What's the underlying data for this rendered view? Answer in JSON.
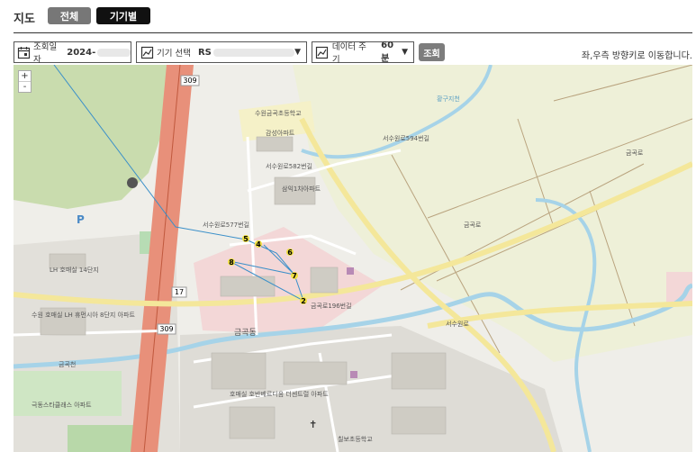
{
  "header": {
    "title": "지도",
    "tab_all": "전체",
    "tab_device": "기기별"
  },
  "toolbar": {
    "date_label": "조회일자",
    "date_value": "2024-",
    "device_label": "기기 선택",
    "device_value": "RS",
    "period_label": "데이터 주기",
    "period_value": "60분",
    "search_button": "조회",
    "hint": "좌,우측 방향키로 이동합니다."
  },
  "map": {
    "zoom_in": "+",
    "zoom_out": "-",
    "route_numbers": [
      "309",
      "309",
      "17"
    ],
    "track_points": [
      "5",
      "4",
      "6",
      "8",
      "7",
      "2"
    ],
    "labels": {
      "school": "수원금곡초등학교",
      "apt_a": "감성아파트",
      "apt_b": "삼익1차아파트",
      "road_1": "서수원로594번길",
      "road_2": "서수원로577번길",
      "road_3": "서수원로582번길",
      "road_4": "금곡로",
      "road_5": "서수원로",
      "road_6": "금곡로196번길",
      "apt_c": "LH 호매실 14단지",
      "apt_d": "수원 호매실 LH 휴먼시아 8단지 아파트",
      "river": "금곡천",
      "district": "금곡동",
      "apt_e": "호매실 호반베르디움 더센트럴 아파트",
      "school2": "칠보초등학교",
      "apt_f": "극동스타클래스 아파트",
      "road_7": "금곡로",
      "water": "황구지천"
    }
  },
  "colors": {
    "active_tab": "#111111",
    "inactive_tab": "#777777",
    "search_button": "#7d7d7d",
    "farmland": "#eef0d8",
    "highway": "#e8907a",
    "water": "#a6d3e8",
    "track_line": "#3a8fc9",
    "marker": "#f0e040"
  }
}
